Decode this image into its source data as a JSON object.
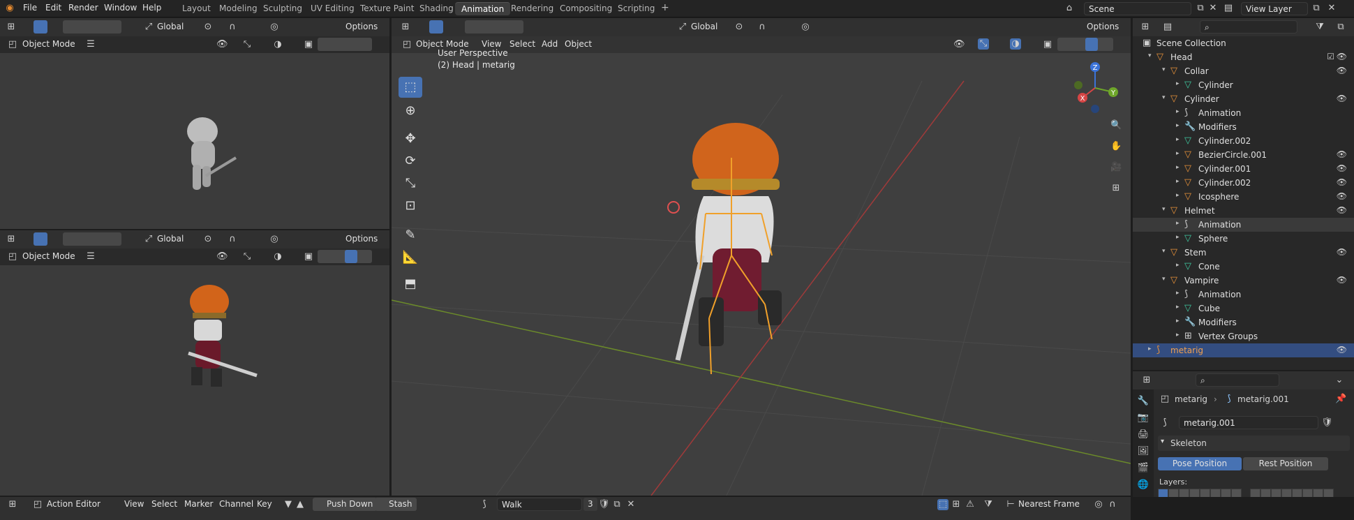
{
  "topbar": {
    "menus": [
      "File",
      "Edit",
      "Render",
      "Window",
      "Help"
    ],
    "workspaces": [
      "Layout",
      "Modeling",
      "Sculpting",
      "UV Editing",
      "Texture Paint",
      "Shading",
      "Animation",
      "Rendering",
      "Compositing",
      "Scripting"
    ],
    "active_workspace": "Animation",
    "add_tab": "+",
    "scene": "Scene",
    "view_layer": "View Layer"
  },
  "left_top": {
    "transform": "Global",
    "options": "Options",
    "mode": "Object Mode"
  },
  "left_bottom": {
    "transform": "Global",
    "options": "Options",
    "mode": "Object Mode"
  },
  "viewport": {
    "mode": "Object Mode",
    "menus": [
      "View",
      "Select",
      "Add",
      "Object"
    ],
    "transform": "Global",
    "options": "Options",
    "overlay_line1": "User Perspective",
    "overlay_line2": "(2) Head | metarig",
    "gizmo": {
      "x": "X",
      "y": "Y",
      "z": "Z"
    }
  },
  "outliner": {
    "search_placeholder": "",
    "rows": [
      {
        "label": "Scene Collection",
        "indent": 0,
        "type": "collection",
        "tri": "",
        "eye": false
      },
      {
        "label": "Head",
        "indent": 1,
        "type": "object",
        "tri": "▾",
        "eye": true,
        "check": true
      },
      {
        "label": "Collar",
        "indent": 2,
        "type": "object",
        "tri": "▾",
        "eye": true
      },
      {
        "label": "Cylinder",
        "indent": 3,
        "type": "mesh",
        "tri": "▸",
        "eye": false
      },
      {
        "label": "Cylinder",
        "indent": 2,
        "type": "object",
        "tri": "▾",
        "eye": true
      },
      {
        "label": "Animation",
        "indent": 3,
        "type": "anim",
        "tri": "▸",
        "eye": false
      },
      {
        "label": "Modifiers",
        "indent": 3,
        "type": "mod",
        "tri": "▸",
        "eye": false
      },
      {
        "label": "Cylinder.002",
        "indent": 3,
        "type": "mesh",
        "tri": "▸",
        "eye": false
      },
      {
        "label": "BezierCircle.001",
        "indent": 3,
        "type": "object",
        "tri": "▸",
        "eye": true
      },
      {
        "label": "Cylinder.001",
        "indent": 3,
        "type": "object",
        "tri": "▸",
        "eye": true
      },
      {
        "label": "Cylinder.002",
        "indent": 3,
        "type": "object",
        "tri": "▸",
        "eye": true
      },
      {
        "label": "Icosphere",
        "indent": 3,
        "type": "object",
        "tri": "▸",
        "eye": true
      },
      {
        "label": "Helmet",
        "indent": 2,
        "type": "object",
        "tri": "▾",
        "eye": true
      },
      {
        "label": "Animation",
        "indent": 3,
        "type": "anim",
        "tri": "▸",
        "eye": false,
        "highlight": true
      },
      {
        "label": "Sphere",
        "indent": 3,
        "type": "mesh",
        "tri": "▸",
        "eye": false
      },
      {
        "label": "Stem",
        "indent": 2,
        "type": "object",
        "tri": "▾",
        "eye": true
      },
      {
        "label": "Cone",
        "indent": 3,
        "type": "mesh",
        "tri": "▸",
        "eye": false
      },
      {
        "label": "Vampire",
        "indent": 2,
        "type": "object",
        "tri": "▾",
        "eye": true
      },
      {
        "label": "Animation",
        "indent": 3,
        "type": "anim",
        "tri": "▸",
        "eye": false
      },
      {
        "label": "Cube",
        "indent": 3,
        "type": "mesh",
        "tri": "▸",
        "eye": false
      },
      {
        "label": "Modifiers",
        "indent": 3,
        "type": "mod",
        "tri": "▸",
        "eye": false
      },
      {
        "label": "Vertex Groups",
        "indent": 3,
        "type": "vgroup",
        "tri": "▸",
        "eye": false
      },
      {
        "label": "metarig",
        "indent": 1,
        "type": "armature",
        "tri": "▸",
        "eye": true,
        "selected": true
      }
    ]
  },
  "properties": {
    "object_name": "metarig",
    "data_name": "metarig.001",
    "armature_field": "metarig.001",
    "panel": "Skeleton",
    "pose_position": "Pose Position",
    "rest_position": "Rest Position",
    "layers_label": "Layers:"
  },
  "action_editor": {
    "editor_type": "Action Editor",
    "menus": [
      "View",
      "Select",
      "Marker",
      "Channel",
      "Key"
    ],
    "push_down": "Push Down",
    "stash": "Stash",
    "action_name": "Walk",
    "user_count": "3",
    "snapping": "Nearest Frame"
  },
  "colors": {
    "accent": "#4772b3",
    "object": "#e8923a",
    "mesh": "#3fc9a0",
    "armature": "#e8923a",
    "selection": "#334d80"
  }
}
